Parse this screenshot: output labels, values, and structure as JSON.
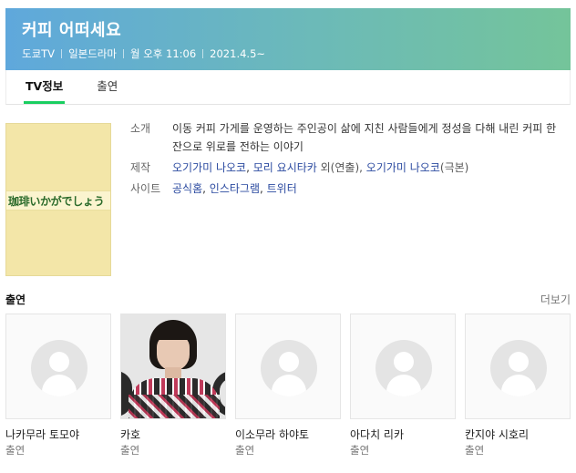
{
  "header": {
    "title": "커피 어떠세요",
    "channel": "도쿄TV",
    "genre": "일본드라마",
    "schedule": "월 오후 11:06",
    "start_date": "2021.4.5~",
    "gradient_colors": [
      "#5fa8dc",
      "#74c49a"
    ]
  },
  "tabs": [
    {
      "label": "TV정보",
      "active": true
    },
    {
      "label": "출연",
      "active": false
    }
  ],
  "poster": {
    "logo_text": "珈琲いかがでしょう"
  },
  "info": {
    "synopsis_label": "소개",
    "synopsis": "이동 커피 가게를 운영하는 주인공이 삶에 지친 사람들에게 정성을 다해 내린 커피 한잔으로 위로를 전하는 이야기",
    "production_label": "제작",
    "director_1": "오기가미 나오코",
    "comma": ",",
    "director_2": "모리 요시타카",
    "director_suffix": " 외(연출),",
    "writer": "오기가미 나오코",
    "writer_suffix": "(극본)",
    "site_label": "사이트",
    "links": [
      "공식홈",
      "인스타그램",
      "트위터"
    ]
  },
  "cast_section": {
    "title": "출연",
    "more_label": "더보기",
    "members": [
      {
        "name": "나카무라 토모야",
        "role": "출연",
        "photo": "placeholder"
      },
      {
        "name": "카호",
        "role": "출연",
        "photo": "portrait"
      },
      {
        "name": "이소무라 하야토",
        "role": "출연",
        "photo": "placeholder"
      },
      {
        "name": "아다치 리카",
        "role": "출연",
        "photo": "placeholder"
      },
      {
        "name": "칸지야 시호리",
        "role": "출연",
        "photo": "placeholder"
      }
    ]
  },
  "colors": {
    "active_tab_underline": "#19ce60",
    "link": "#2b4aa0"
  }
}
